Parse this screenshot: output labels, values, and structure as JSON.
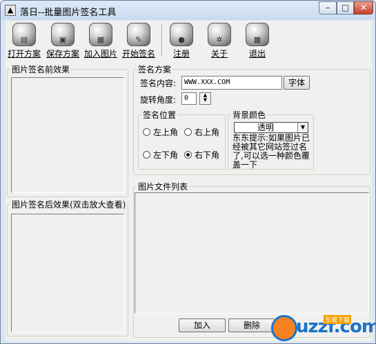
{
  "window": {
    "title": "落日--批量图片签名工具"
  },
  "toolbar": [
    {
      "label": "打开方案",
      "icon": "open-plan-icon"
    },
    {
      "label": "保存方案",
      "icon": "save-plan-icon"
    },
    {
      "label": "加入图片",
      "icon": "add-image-icon"
    },
    {
      "label": "开始签名",
      "icon": "start-sign-icon"
    },
    {
      "label": "注册",
      "icon": "apple-register-icon"
    },
    {
      "label": "关于",
      "icon": "gear-about-icon"
    },
    {
      "label": "退出",
      "icon": "exit-icon"
    }
  ],
  "panels": {
    "before": "图片签名前效果",
    "after": "图片签名后效果(双击放大查看)",
    "file_list": "图片文件列表"
  },
  "scheme": {
    "title": "签名方案",
    "content_label": "签名内容:",
    "content_value": "WWW.XXX.COM",
    "font_button": "字体",
    "rotation_label": "旋转角度:",
    "rotation_value": "0"
  },
  "position": {
    "title": "签名位置",
    "options": [
      "左上角",
      "右上角",
      "左下角",
      "右下角"
    ],
    "selected": "右下角"
  },
  "background": {
    "title": "背景颜色",
    "selected": "透明",
    "hint": "东东提示:如果图片已经被其它网站签过名了,可以选一种颜色覆盖一下"
  },
  "bottom_buttons": {
    "add": "加入",
    "delete": "删除"
  },
  "watermark": {
    "text": "uzzf.com",
    "badge": "东坡下载"
  }
}
